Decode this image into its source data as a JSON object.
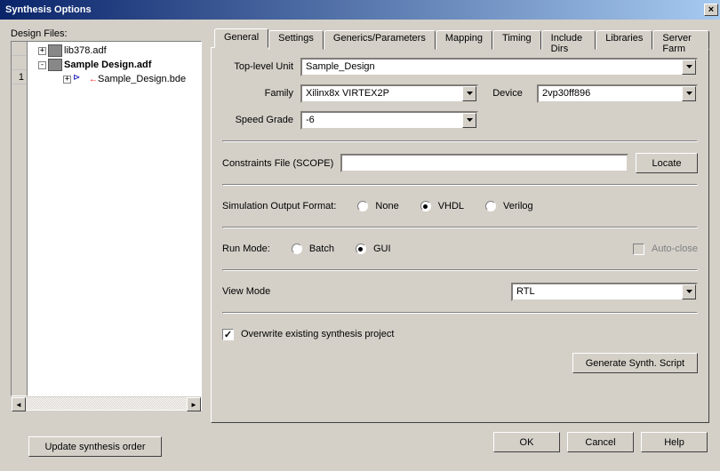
{
  "window": {
    "title": "Synthesis Options",
    "close": "×"
  },
  "left": {
    "label": "Design Files:",
    "gutter_num": "1",
    "tree": {
      "n1": "lib378.adf",
      "n2": "Sample Design.adf",
      "n3": "Sample_Design.bde"
    },
    "update_btn": "Update synthesis order"
  },
  "tabs": [
    "General",
    "Settings",
    "Generics/Parameters",
    "Mapping",
    "Timing",
    "Include Dirs",
    "Libraries",
    "Server Farm"
  ],
  "general": {
    "top_unit_label": "Top-level Unit",
    "top_unit_value": "Sample_Design",
    "family_label": "Family",
    "family_value": "Xilinx8x VIRTEX2P",
    "device_label": "Device",
    "device_value": "2vp30ff896",
    "speed_label": "Speed Grade",
    "speed_value": "-6",
    "constraints_label": "Constraints File (SCOPE)",
    "constraints_value": "",
    "locate_btn": "Locate",
    "sim_fmt_label": "Simulation Output Format:",
    "sim_opts": {
      "none": "None",
      "vhdl": "VHDL",
      "verilog": "Verilog"
    },
    "run_mode_label": "Run Mode:",
    "run_opts": {
      "batch": "Batch",
      "gui": "GUI"
    },
    "autoclose_label": "Auto-close",
    "view_mode_label": "View Mode",
    "view_mode_value": "RTL",
    "overwrite_label": "Overwrite existing synthesis project",
    "gen_script_btn": "Generate Synth. Script"
  },
  "buttons": {
    "ok": "OK",
    "cancel": "Cancel",
    "help": "Help"
  }
}
